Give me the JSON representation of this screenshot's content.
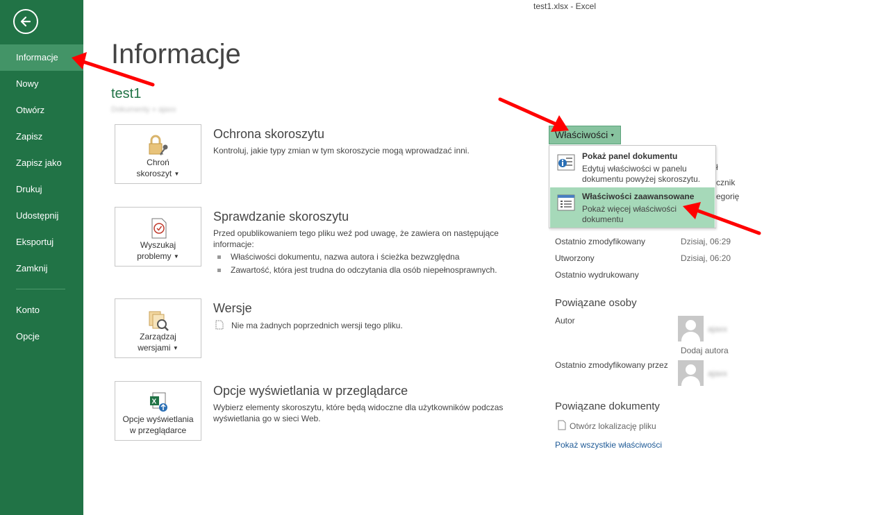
{
  "window": {
    "title": "test1.xlsx - Excel"
  },
  "sidebar": {
    "items": [
      {
        "label": "Informacje"
      },
      {
        "label": "Nowy"
      },
      {
        "label": "Otwórz"
      },
      {
        "label": "Zapisz"
      },
      {
        "label": "Zapisz jako"
      },
      {
        "label": "Drukuj"
      },
      {
        "label": "Udostępnij"
      },
      {
        "label": "Eksportuj"
      },
      {
        "label": "Zamknij"
      },
      {
        "label": "Konto"
      },
      {
        "label": "Opcje"
      }
    ]
  },
  "main": {
    "title": "Informacje",
    "doc_name": "test1",
    "doc_location": "Dokumenty » ajaxx",
    "sections": [
      {
        "button_line1": "Chroń",
        "button_line2": "skoroszyt",
        "icon": "lock-icon",
        "title": "Ochrona skoroszytu",
        "text": "Kontroluj, jakie typy zmian w tym skoroszycie mogą wprowadzać inni."
      },
      {
        "button_line1": "Wyszukaj",
        "button_line2": "problemy",
        "icon": "inspect-icon",
        "title": "Sprawdzanie skoroszytu",
        "text": "Przed opublikowaniem tego pliku weź pod uwagę, że zawiera on następujące informacje:",
        "bullets": [
          "Właściwości dokumentu, nazwa autora i ścieżka bezwzględna",
          "Zawartość, która jest trudna do odczytania dla osób niepełnosprawnych."
        ]
      },
      {
        "button_line1": "Zarządzaj",
        "button_line2": "wersjami",
        "icon": "versions-icon",
        "title": "Wersje",
        "text": "Nie ma żadnych poprzednich wersji tego pliku."
      },
      {
        "button_line1": "Opcje wyświetlania",
        "button_line2": "w przeglądarce",
        "icon": "browser-view-icon",
        "title": "Opcje wyświetlania w przeglądarce",
        "text": "Wybierz elementy skoroszytu, które będą widoczne dla użytkowników podczas wyświetlania go w sieci Web."
      }
    ]
  },
  "properties": {
    "button_label": "Właściwości",
    "dropdown": [
      {
        "title": "Pokaż panel dokumentu",
        "desc": "Edytuj właściwości w panelu dokumentu powyżej skoroszytu.",
        "icon": "document-panel-icon"
      },
      {
        "title": "Właściwości zaawansowane",
        "desc": "Pokaż więcej właściwości dokumentu",
        "icon": "advanced-properties-icon"
      }
    ],
    "partial_labels": [
      "ł",
      "cznik",
      "egorię"
    ],
    "dates": [
      {
        "label": "Ostatnio zmodyfikowany",
        "value": "Dzisiaj, 06:29"
      },
      {
        "label": "Utworzony",
        "value": "Dzisiaj, 06:20"
      },
      {
        "label": "Ostatnio wydrukowany",
        "value": ""
      }
    ],
    "people_heading": "Powiązane osoby",
    "author_label": "Autor",
    "author_name": "ajaxx",
    "add_author": "Dodaj autora",
    "modified_by_label": "Ostatnio zmodyfikowany przez",
    "modified_by_name": "ajaxx",
    "docs_heading": "Powiązane dokumenty",
    "open_location": "Otwórz lokalizację pliku",
    "show_all": "Pokaż wszystkie właściwości"
  },
  "colors": {
    "brand": "#217346",
    "active": "#439467",
    "highlight": "#a6d9b9",
    "annotation_arrow": "#ff0000"
  }
}
